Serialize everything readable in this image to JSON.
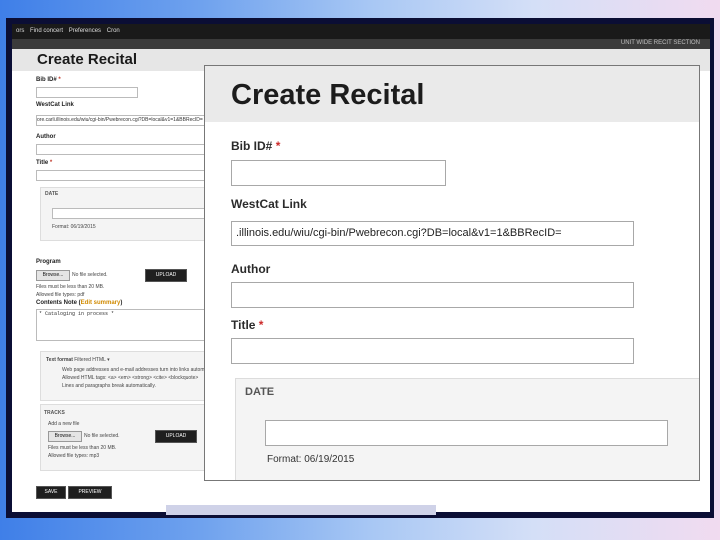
{
  "top_nav": [
    "ors",
    "Find concert",
    "Preferences",
    "Cron"
  ],
  "subbar_right": "UNIT WIDE RECIT SECTION",
  "bg_form": {
    "title": "Create Recital",
    "bib_label": "Bib ID#",
    "westcat_label": "WestCat Link",
    "westcat_value": "ore.carli.illinois.edu/wiu/cgi-bin/Pwebrecon.cgi?DB=local&v1=1&BBRecID=",
    "author_label": "Author",
    "title_label": "Title",
    "date_legend": "DATE",
    "date_format": "Format: 06/19/2015",
    "program_label": "Program",
    "browse_label": "Browse...",
    "no_file": "No file selected.",
    "upload_label": "UPLOAD",
    "files_less": "Files must be less than 20 MB.",
    "allowed_pdf": "Allowed file types: pdf",
    "contents_label": "Contents Note",
    "contents_link": "Edit summary",
    "contents_value": "* Cataloging in process *",
    "text_format_label": "Text format",
    "text_format_value": "Filtered HTML",
    "format_tips": [
      "Web page addresses and e-mail addresses turn into links automatically.",
      "Allowed HTML tags: <a> <em> <strong> <cite> <blockquote>",
      "Lines and paragraphs break automatically."
    ],
    "tracks_label": "TRACKS",
    "add_file_label": "Add a new file",
    "allowed_mp3": "Allowed file types: mp3",
    "save_label": "SAVE",
    "preview_label": "PREVIEW"
  },
  "zoom": {
    "title": "Create Recital",
    "bib_label": "Bib ID#",
    "required_mark": "*",
    "bib_value": "",
    "westcat_label": "WestCat Link",
    "westcat_value": ".illinois.edu/wiu/cgi-bin/Pwebrecon.cgi?DB=local&v1=1&BBRecID=",
    "author_label": "Author",
    "author_value": "",
    "title_label": "Title",
    "title_value": "",
    "date_legend": "DATE",
    "date_value": "",
    "date_format": "Format: 06/19/2015"
  },
  "colors": {
    "required": "#cc2a2a",
    "frame": "#0b0e35",
    "topbar": "#1a1a1a"
  }
}
